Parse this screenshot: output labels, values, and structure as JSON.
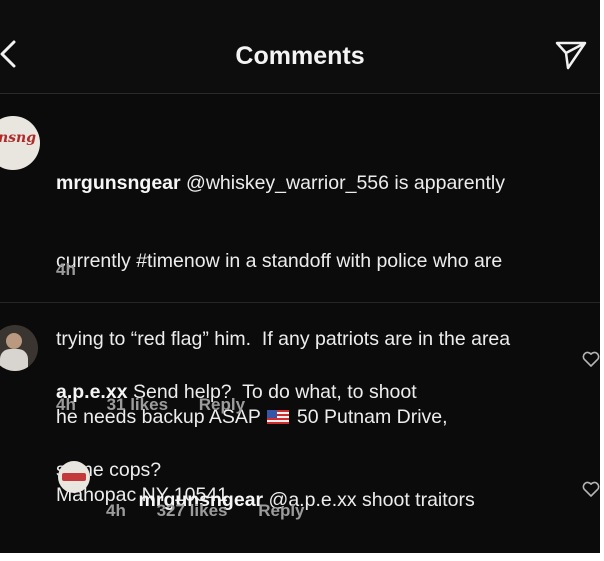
{
  "header": {
    "title": "Comments",
    "back_icon": "chevron-left-icon",
    "send_icon": "paper-plane-icon"
  },
  "post": {
    "username": "mrgunsngear",
    "avatar_text": "nsng",
    "line1": " @whiskey_warrior_556 is apparently",
    "line2": "currently #timenow in a standoff with police who are",
    "line3": "trying to “red flag” him.  If any patriots are in the area",
    "line4a": "he needs backup ASAP",
    "line4b": "50 Putnam Drive,",
    "line5": "Mahopac NY 10541",
    "time": "4h"
  },
  "comment1": {
    "username": "a.p.e.xx",
    "line1": " Send help?  To do what, to shoot",
    "line2": "some cops?",
    "time": "4h",
    "likes": "31 likes",
    "reply": "Reply"
  },
  "reply1": {
    "username": "mrgunsngear",
    "text": " @a.p.e.xx shoot traitors",
    "time": "4h",
    "likes": "327 likes",
    "reply": "Reply"
  },
  "colors": {
    "background": "#0b0b0b",
    "text": "#ededed",
    "meta": "#9c9c9c"
  }
}
